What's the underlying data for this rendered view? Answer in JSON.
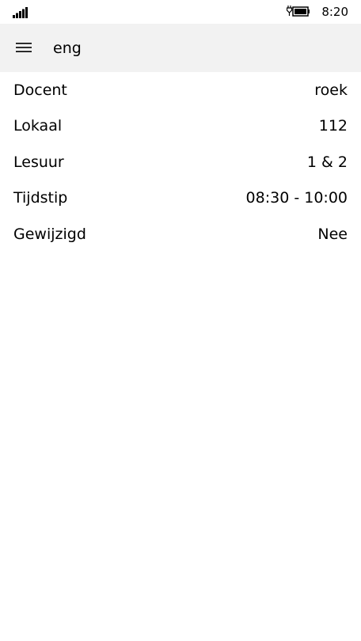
{
  "status_bar": {
    "signal_icon": "signal-strength-icon",
    "battery_icon": "battery-charging-icon",
    "time": "8:20"
  },
  "app_bar": {
    "menu_icon": "hamburger-menu-icon",
    "title": "eng"
  },
  "details": [
    {
      "label": "Docent",
      "value": "roek"
    },
    {
      "label": "Lokaal",
      "value": "112"
    },
    {
      "label": "Lesuur",
      "value": "1 & 2"
    },
    {
      "label": "Tijdstip",
      "value": "08:30 - 10:00"
    },
    {
      "label": "Gewijzigd",
      "value": "Nee"
    }
  ]
}
